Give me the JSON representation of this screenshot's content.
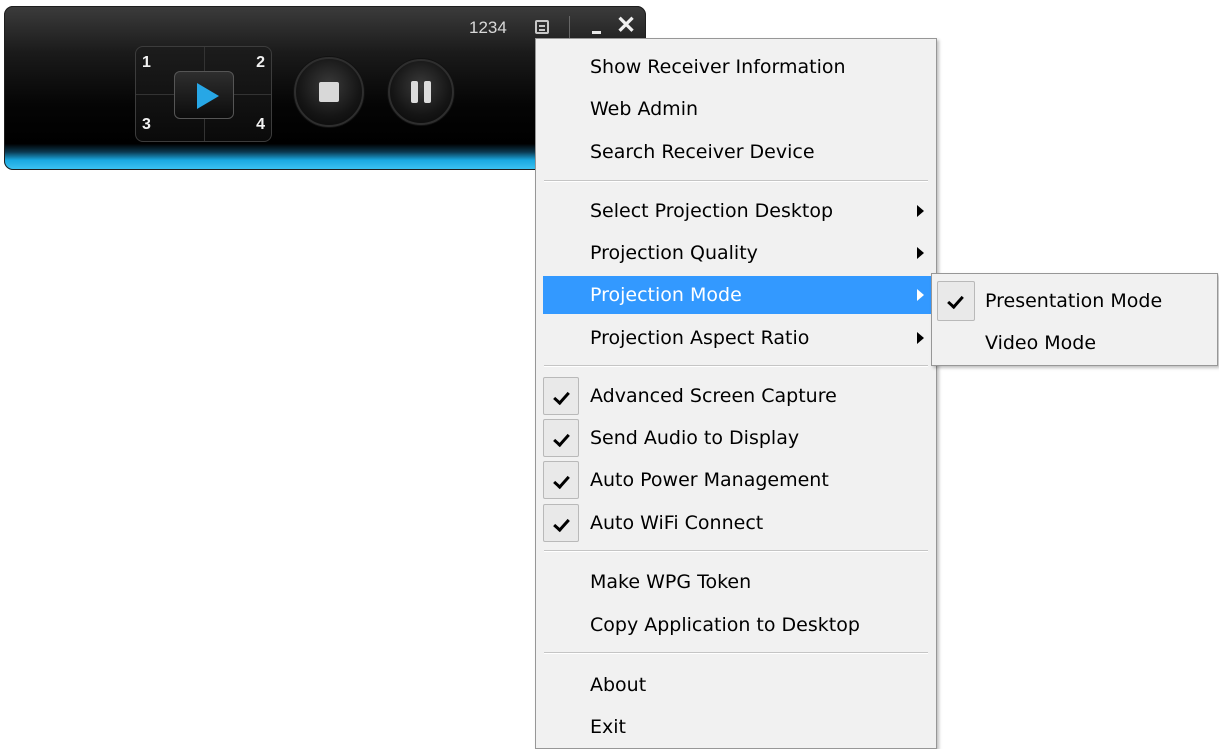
{
  "player": {
    "code": "1234",
    "quadrants": [
      "1",
      "2",
      "3",
      "4"
    ]
  },
  "menu": {
    "items": [
      {
        "label": "Show Receiver Information"
      },
      {
        "label": "Web Admin"
      },
      {
        "label": "Search Receiver Device"
      },
      {
        "label": "Select Projection Desktop",
        "submenu": true
      },
      {
        "label": "Projection Quality",
        "submenu": true
      },
      {
        "label": "Projection Mode",
        "submenu": true,
        "highlighted": true
      },
      {
        "label": "Projection Aspect Ratio",
        "submenu": true
      },
      {
        "label": "Advanced Screen Capture",
        "checked": true
      },
      {
        "label": "Send Audio to Display",
        "checked": true
      },
      {
        "label": "Auto Power Management",
        "checked": true
      },
      {
        "label": "Auto WiFi Connect",
        "checked": true
      },
      {
        "label": "Make WPG Token"
      },
      {
        "label": "Copy Application to Desktop"
      },
      {
        "label": "About"
      },
      {
        "label": "Exit"
      }
    ]
  },
  "submenu": {
    "items": [
      {
        "label": "Presentation Mode",
        "checked": true
      },
      {
        "label": "Video Mode",
        "checked": false
      }
    ]
  },
  "colors": {
    "highlight": "#3399ff",
    "play_accent": "#27a7e6",
    "bar_glow": "#3fc4f2"
  },
  "icons": [
    "layout-icon",
    "minimize-icon",
    "close-icon",
    "play-icon",
    "stop-icon",
    "pause-icon",
    "check-icon",
    "submenu-arrow-icon"
  ]
}
